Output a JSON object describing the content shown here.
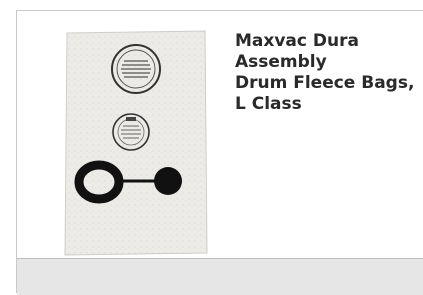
{
  "product": {
    "title_lines": [
      "Maxvac Dura",
      "Assembly",
      "Drum Fleece Bags,",
      "L Class"
    ],
    "image_name": "fleece-bag-image"
  },
  "colors": {
    "border": "#c9c9c9",
    "footer": "#e6e6e6",
    "title_text": "#2a2a2a"
  }
}
